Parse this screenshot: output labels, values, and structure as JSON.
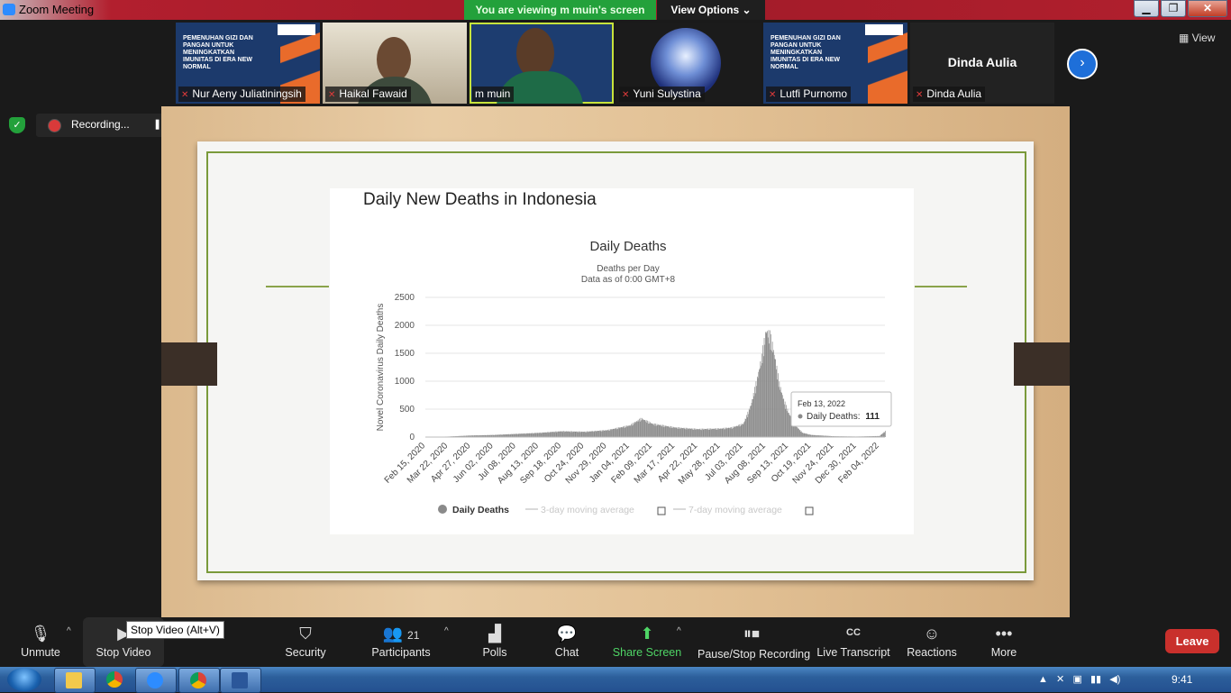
{
  "window": {
    "title": "Zoom Meeting",
    "minimize": "▁",
    "maximize": "❐",
    "close": "✕"
  },
  "banner": {
    "viewing": "You are viewing m muin's screen",
    "view_options": "View Options ⌄"
  },
  "participants_strip": {
    "tiles": [
      {
        "name": "Nur Aeny Juliatiningsih",
        "thumb_text": "PEMENUHAN GIZI DAN PANGAN UNTUK MENINGKATKAN IMUNITAS DI ERA NEW NORMAL"
      },
      {
        "name": "Haikal Fawaid"
      },
      {
        "name": "m muin"
      },
      {
        "name": "Yuni Sulystina"
      },
      {
        "name": "Lutfi Purnomo",
        "thumb_text": "PEMENUHAN GIZI DAN PANGAN UNTUK MENINGKATKAN IMUNITAS DI ERA NEW NORMAL"
      },
      {
        "name": "Dinda Aulia",
        "display_name": "Dinda Aulia"
      }
    ],
    "next_arrow": "›",
    "view_label": "View"
  },
  "recording": {
    "label": "Recording...",
    "pause": "❚❚"
  },
  "chart_data": {
    "type": "bar",
    "title": "Daily Deaths",
    "subtitle": [
      "Deaths per Day",
      "Data as of 0:00 GMT+8"
    ],
    "ylabel": "Novel Coronavirus Daily Deaths",
    "xlabel": "",
    "ylim": [
      0,
      2500
    ],
    "yticks": [
      0,
      500,
      1000,
      1500,
      2000,
      2500
    ],
    "xticks": [
      "Feb 15, 2020",
      "Mar 22, 2020",
      "Apr 27, 2020",
      "Jun 02, 2020",
      "Jul 08, 2020",
      "Aug 13, 2020",
      "Sep 18, 2020",
      "Oct 24, 2020",
      "Nov 29, 2020",
      "Jan 04, 2021",
      "Feb 09, 2021",
      "Mar 17, 2021",
      "Apr 22, 2021",
      "May 28, 2021",
      "Jul 03, 2021",
      "Aug 08, 2021",
      "Sep 13, 2021",
      "Oct 19, 2021",
      "Nov 24, 2021",
      "Dec 30, 2021",
      "Feb 04, 2022"
    ],
    "series": [
      {
        "name": "Daily Deaths",
        "x": [
          "Feb 15, 2020",
          "Mar 22, 2020",
          "Apr 27, 2020",
          "Jun 02, 2020",
          "Jul 08, 2020",
          "Aug 13, 2020",
          "Sep 18, 2020",
          "Oct 24, 2020",
          "Nov 29, 2020",
          "Jan 04, 2021",
          "Jan 22, 2021",
          "Feb 09, 2021",
          "Mar 17, 2021",
          "Apr 22, 2021",
          "May 28, 2021",
          "Jun 15, 2021",
          "Jul 03, 2021",
          "Jul 15, 2021",
          "Jul 25, 2021",
          "Aug 01, 2021",
          "Aug 08, 2021",
          "Aug 15, 2021",
          "Aug 22, 2021",
          "Aug 29, 2021",
          "Sep 05, 2021",
          "Sep 13, 2021",
          "Sep 25, 2021",
          "Oct 05, 2021",
          "Oct 19, 2021",
          "Nov 24, 2021",
          "Dec 30, 2021",
          "Feb 04, 2022",
          "Feb 13, 2022"
        ],
        "values": [
          0,
          10,
          30,
          40,
          60,
          80,
          110,
          100,
          130,
          220,
          350,
          250,
          180,
          150,
          160,
          180,
          250,
          600,
          1100,
          1500,
          2000,
          1900,
          1500,
          1000,
          700,
          450,
          200,
          80,
          40,
          15,
          10,
          20,
          111
        ]
      },
      {
        "name": "3-day moving average"
      },
      {
        "name": "7-day moving average"
      }
    ],
    "legend": "bottom",
    "tooltip": {
      "date": "Feb 13, 2022",
      "label": "Daily Deaths:",
      "value": "111"
    },
    "bar_color": "#8a8a8a",
    "grid": true
  },
  "slide": {
    "heading": "Daily New Deaths in Indonesia"
  },
  "toolbar": {
    "unmute": "Unmute",
    "stop_video": "Stop Video",
    "stop_video_tip": "Stop Video (Alt+V)",
    "security": "Security",
    "participants": "Participants",
    "participants_count": "21",
    "polls": "Polls",
    "chat": "Chat",
    "share_screen": "Share Screen",
    "pause_stop_recording": "Pause/Stop Recording",
    "live_transcript": "Live Transcript",
    "cc": "CC",
    "reactions": "Reactions",
    "more": "More",
    "leave": "Leave"
  },
  "taskbar": {
    "clock": "9:41"
  }
}
